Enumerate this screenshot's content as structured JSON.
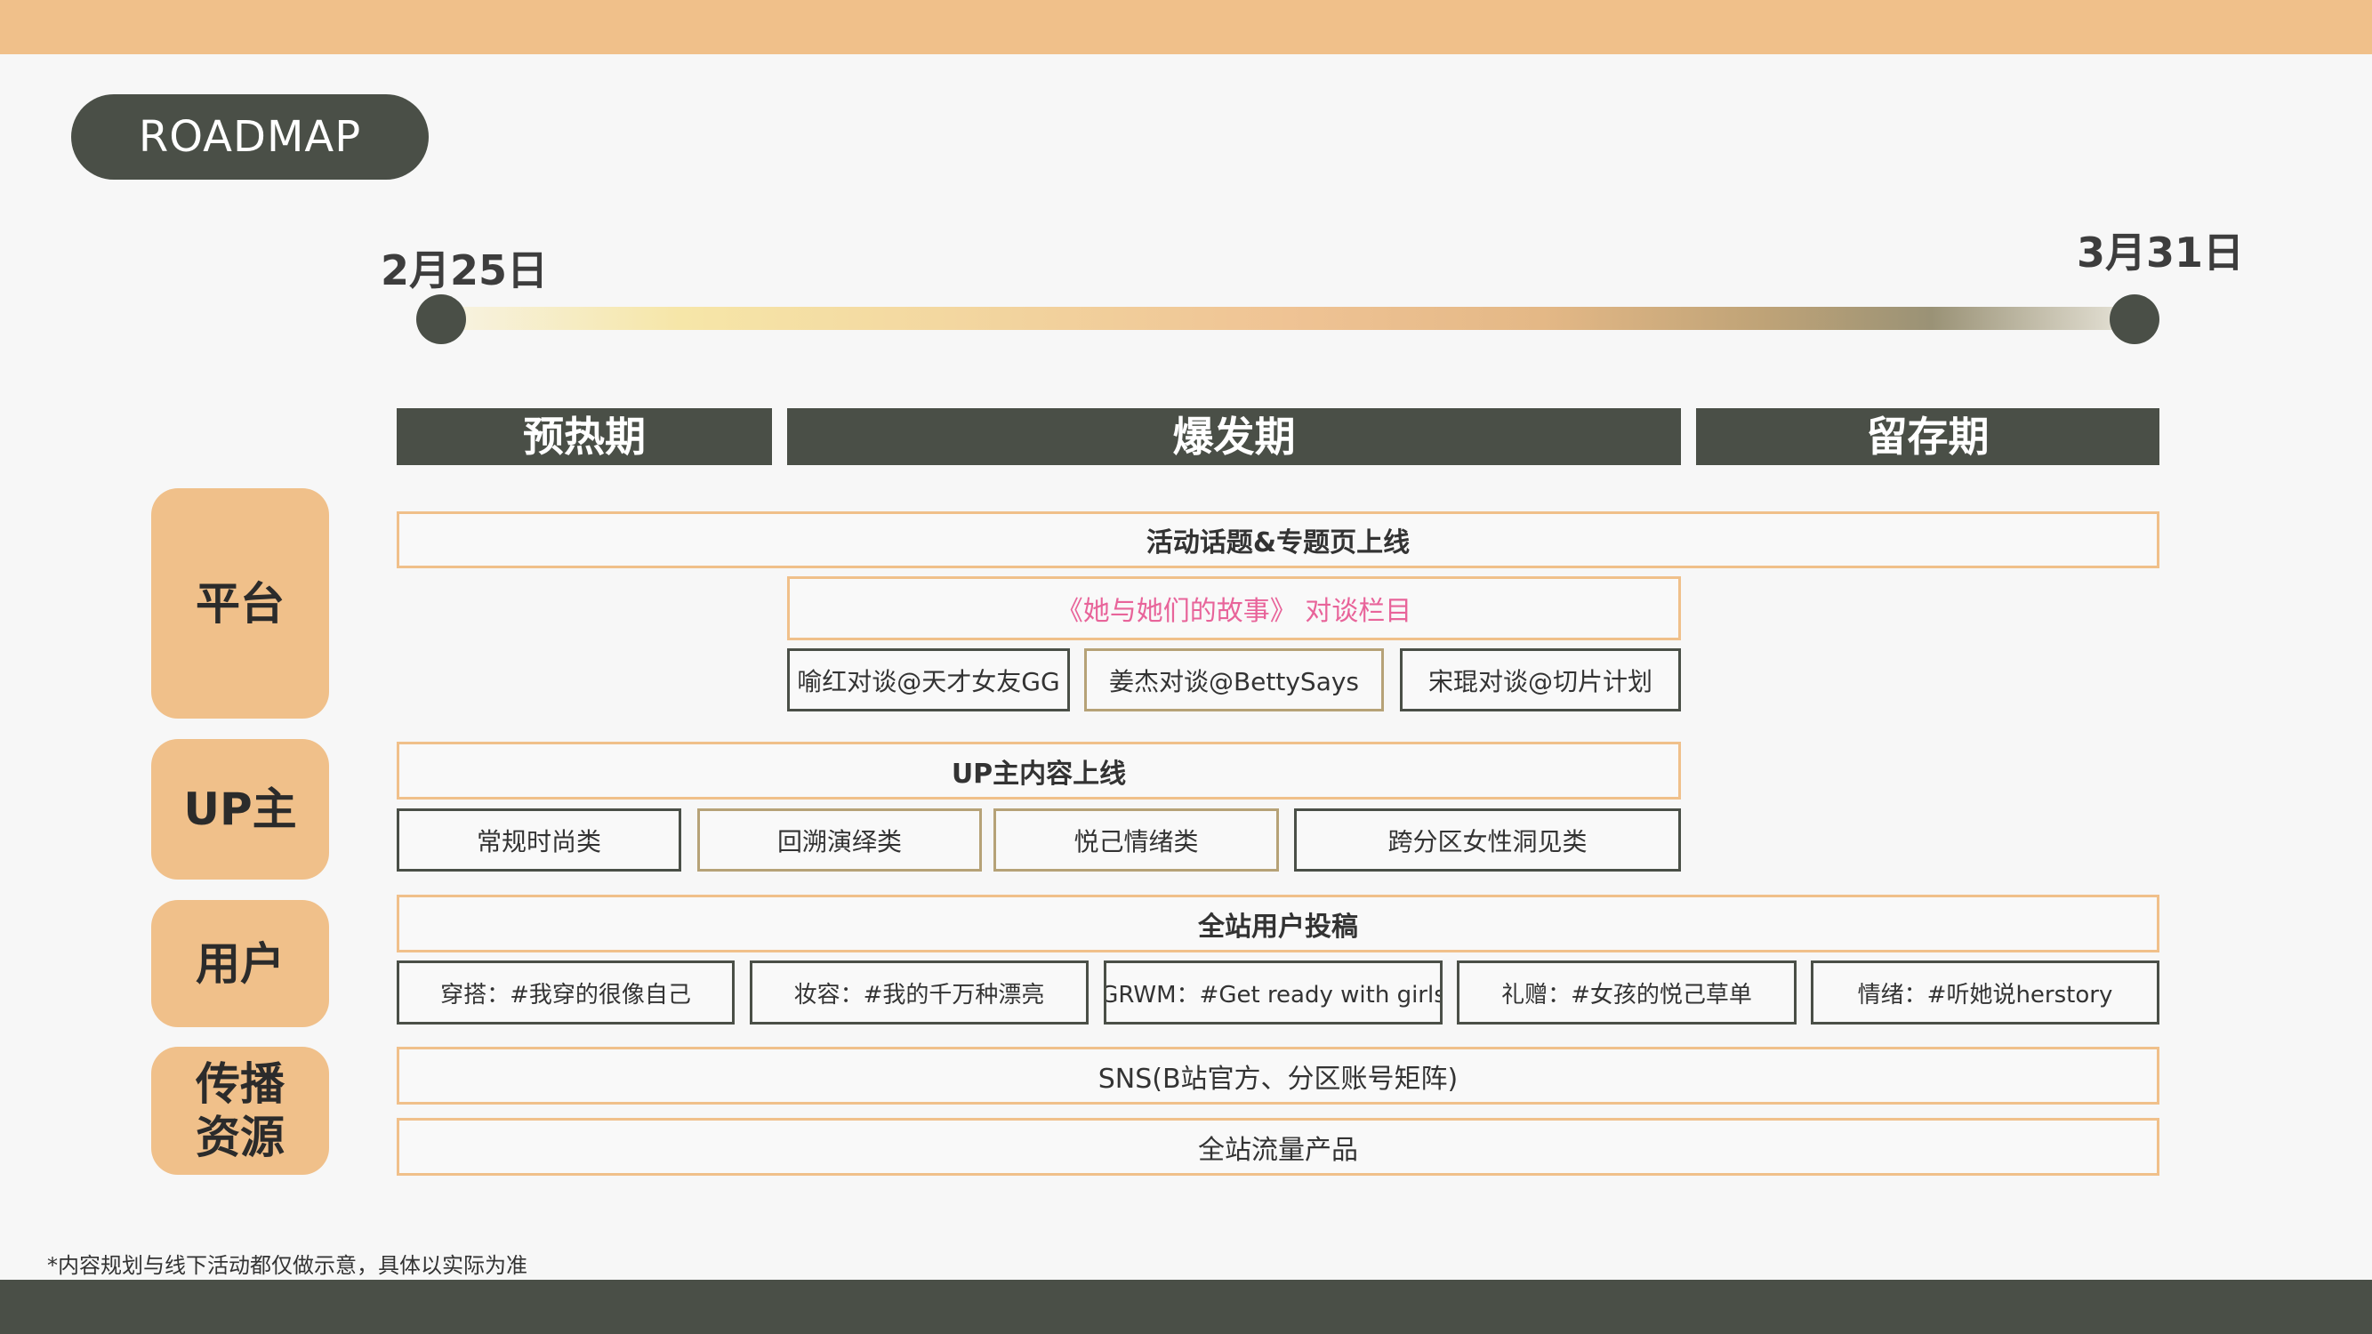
{
  "header": {
    "title": "ROADMAP"
  },
  "timeline": {
    "start_label": "2月25日",
    "end_label": "3月31日"
  },
  "phases": [
    {
      "label": "预热期"
    },
    {
      "label": "爆发期"
    },
    {
      "label": "留存期"
    }
  ],
  "rows": {
    "platform": {
      "label": "平台",
      "main": "活动话题&专题页上线",
      "column": "《她与她们的故事》 对谈栏目",
      "talks": [
        "喻红对谈@天才女友GG",
        "姜杰对谈@BettySays",
        "宋琨对谈@切片计划"
      ]
    },
    "up": {
      "label": "UP主",
      "main": "UP主内容上线",
      "categories": [
        "常规时尚类",
        "回溯演绎类",
        "悦己情绪类",
        "跨分区女性洞见类"
      ]
    },
    "user": {
      "label": "用户",
      "main": "全站用户投稿",
      "topics": [
        "穿搭：#我穿的很像自己",
        "妆容：#我的千万种漂亮",
        "GRWM：#Get ready with girls",
        "礼赠：#女孩的悦己草单",
        "情绪：#听她说herstory"
      ]
    },
    "spread": {
      "label": "传播\n资源",
      "sns": "SNS(B站官方、分区账号矩阵)",
      "traffic": "全站流量产品"
    }
  },
  "footnote": "*内容规划与线下活动都仅做示意，具体以实际为准",
  "colors": {
    "accent": "#f0c08a",
    "dark": "#4a4f47",
    "highlight": "#e8649a"
  }
}
